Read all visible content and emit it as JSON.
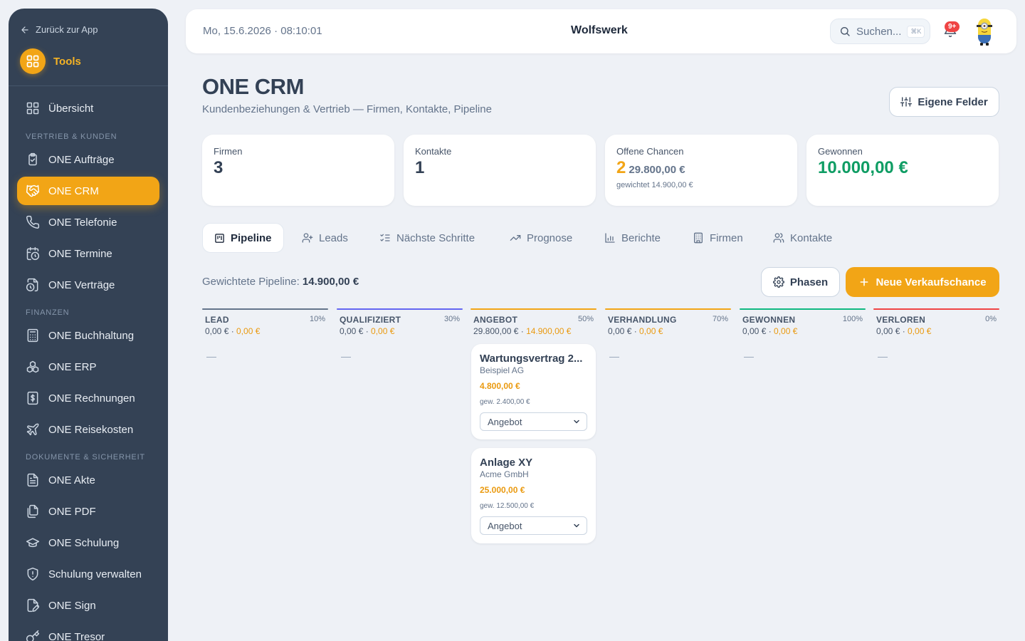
{
  "sidebar": {
    "back_label": "Zurück zur App",
    "tools_label": "Tools",
    "overview_label": "Übersicht",
    "sections": {
      "sales": "VERTRIEB & KUNDEN",
      "finance": "FINANZEN",
      "docs": "DOKUMENTE & SICHERHEIT"
    },
    "items": [
      {
        "label": "ONE Aufträge",
        "icon": "clipboard-check-icon"
      },
      {
        "label": "ONE CRM",
        "icon": "handshake-icon",
        "active": true
      },
      {
        "label": "ONE Telefonie",
        "icon": "phone-icon"
      },
      {
        "label": "ONE Termine",
        "icon": "calendar-clock-icon"
      },
      {
        "label": "ONE Verträge",
        "icon": "file-clock-icon"
      },
      {
        "label": "ONE Buchhaltung",
        "icon": "calculator-icon"
      },
      {
        "label": "ONE ERP",
        "icon": "boxes-icon"
      },
      {
        "label": "ONE Rechnungen",
        "icon": "receipt-dollar-icon"
      },
      {
        "label": "ONE Reisekosten",
        "icon": "plane-icon"
      },
      {
        "label": "ONE Akte",
        "icon": "file-text-icon"
      },
      {
        "label": "ONE PDF",
        "icon": "files-icon"
      },
      {
        "label": "ONE Schulung",
        "icon": "graduation-cap-icon"
      },
      {
        "label": "Schulung verwalten",
        "icon": "shield-alert-icon"
      },
      {
        "label": "ONE Sign",
        "icon": "file-signature-icon"
      },
      {
        "label": "ONE Tresor",
        "icon": "key-icon"
      }
    ]
  },
  "topbar": {
    "datetime": "Mo, 15.6.2026 · 08:10:01",
    "brand": "Wolfswerk",
    "search_placeholder": "Suchen...",
    "search_shortcut": "⌘K",
    "notification_count": "9+"
  },
  "header": {
    "title": "ONE CRM",
    "subtitle": "Kundenbeziehungen & Vertrieb — Firmen, Kontakte, Pipeline",
    "own_fields_label": "Eigene Felder"
  },
  "stats": {
    "companies": {
      "label": "Firmen",
      "value": "3"
    },
    "contacts": {
      "label": "Kontakte",
      "value": "1"
    },
    "open": {
      "label": "Offene Chancen",
      "value": "2",
      "amount": "29.800,00 €",
      "note": "gewichtet 14.900,00 €"
    },
    "won": {
      "label": "Gewonnen",
      "value": "10.000,00 €"
    }
  },
  "tabs": [
    "Pipeline",
    "Leads",
    "Nächste Schritte",
    "Prognose",
    "Berichte",
    "Firmen",
    "Kontakte"
  ],
  "pipeline": {
    "weighted_label": "Gewichtete Pipeline:",
    "weighted_value": "14.900,00 €",
    "phases_label": "Phasen",
    "new_label": "Neue Verkaufschance",
    "empty": "—",
    "columns": [
      {
        "name": "LEAD",
        "pct": "10%",
        "sum": "0,00 €",
        "weighted": "0,00 €",
        "color": "#64748b"
      },
      {
        "name": "QUALIFIZIERT",
        "pct": "30%",
        "sum": "0,00 €",
        "weighted": "0,00 €",
        "color": "#6366f1"
      },
      {
        "name": "ANGEBOT",
        "pct": "50%",
        "sum": "29.800,00 €",
        "weighted": "14.900,00 €",
        "color": "#f2a516"
      },
      {
        "name": "VERHANDLUNG",
        "pct": "70%",
        "sum": "0,00 €",
        "weighted": "0,00 €",
        "color": "#f2a516"
      },
      {
        "name": "GEWONNEN",
        "pct": "100%",
        "sum": "0,00 €",
        "weighted": "0,00 €",
        "color": "#10b981"
      },
      {
        "name": "VERLOREN",
        "pct": "0%",
        "sum": "0,00 €",
        "weighted": "0,00 €",
        "color": "#ef4444"
      }
    ],
    "deals": [
      {
        "title": "Wartungsvertrag 2...",
        "company": "Beispiel AG",
        "amount": "4.800,00 €",
        "weighted": "gew. 2.400,00 €",
        "stage": "Angebot"
      },
      {
        "title": "Anlage XY",
        "company": "Acme GmbH",
        "amount": "25.000,00 €",
        "weighted": "gew. 12.500,00 €",
        "stage": "Angebot"
      }
    ]
  },
  "colors": {
    "accent": "#f2a516",
    "won": "#0f9d64",
    "sidebar": "#344255"
  }
}
